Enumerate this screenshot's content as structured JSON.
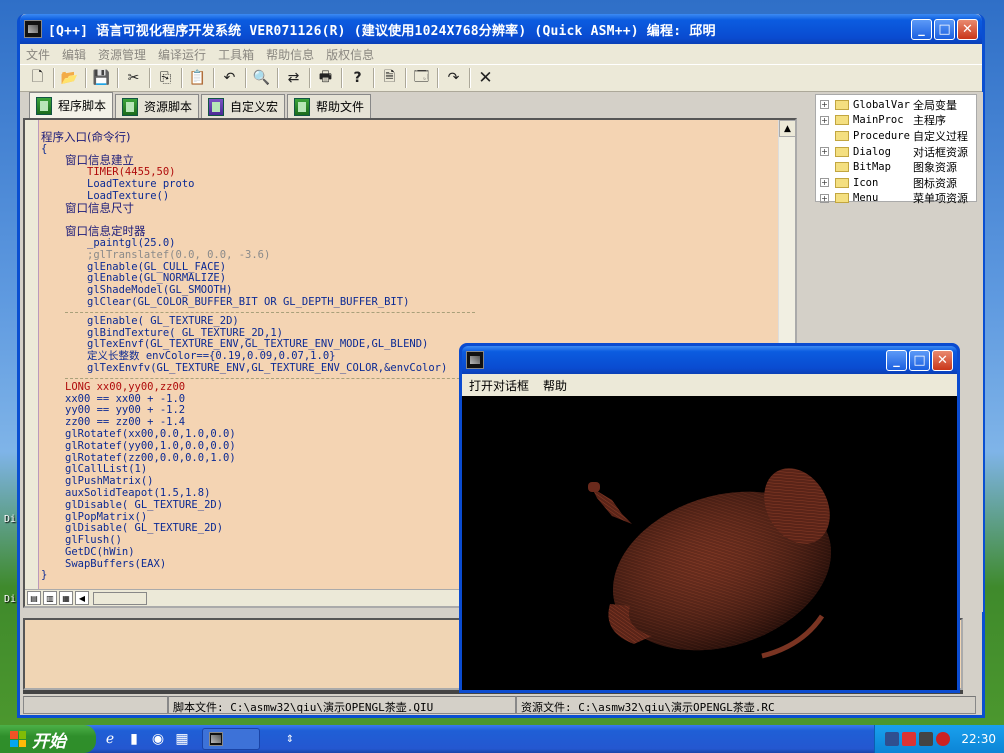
{
  "window": {
    "title": "[Q++] 语言可视化程序开发系统  VER071126(R) (建议使用1024X768分辨率) (Quick ASM++) 编程: 邱明",
    "min_label": "_",
    "max_label": "□",
    "close_label": "✕"
  },
  "menu": [
    "文件",
    "编辑",
    "资源管理",
    "编译运行",
    "工具箱",
    "帮助信息",
    "版权信息"
  ],
  "toolbar": {
    "icons": [
      "new-file-icon",
      "open-folder-icon",
      "save-icon",
      "cut-icon",
      "copy-icon",
      "paste-icon",
      "undo-icon",
      "find-icon",
      "replace-icon",
      "print-icon",
      "context-help-icon",
      "preview-icon",
      "properties-icon",
      "redo-icon",
      "close-icon"
    ],
    "glyphs": [
      "🗋",
      "📂",
      "💾",
      "✂",
      "⎘",
      "📋",
      "↶",
      "🔍",
      "⇄",
      "🖶",
      "?",
      "🗎",
      "🗔",
      "↷",
      "✕"
    ]
  },
  "tabs": [
    "程序脚本",
    "资源脚本",
    "自定义宏",
    "帮助文件"
  ],
  "code": {
    "header": "程序入口(命令行)",
    "brace_open": "{",
    "sec1": "窗口信息建立",
    "timer": "TIMER(4455,50)",
    "load1": "LoadTexture proto",
    "load2": "LoadTexture()",
    "sec2": "窗口信息尺寸",
    "sec3": "窗口信息定时器",
    "paint": "_paintgl(25.0)",
    "translate": ";glTranslatef(0.0, 0.0, -3.6)",
    "e1": "glEnable(GL_CULL_FACE)",
    "e2": "glEnable(GL_NORMALIZE)",
    "shade": "glShadeModel(GL_SMOOTH)",
    "clear": "glClear(GL_COLOR_BUFFER_BIT OR GL_DEPTH_BUFFER_BIT)",
    "e3": "glEnable( GL_TEXTURE_2D)",
    "bind": "glBindTexture( GL_TEXTURE_2D,1)",
    "texenvf": "glTexEnvf(GL_TEXTURE_ENV,GL_TEXTURE_ENV_MODE,GL_BLEND)",
    "define": "定义长整数 envColor=={0.19,0.09,0.07,1.0}",
    "texenvfv": "glTexEnvfv(GL_TEXTURE_ENV,GL_TEXTURE_ENV_COLOR,&envColor)",
    "long": "LONG xx00,yy00,zz00",
    "xx": "xx00 == xx00 + -1.0",
    "yy": "yy00 == yy00 + -1.2",
    "zz": "zz00 == zz00 + -1.4",
    "r1": "glRotatef(xx00,0.0,1.0,0.0)",
    "r2": "glRotatef(yy00,1.0,0.0,0.0)",
    "r3": "glRotatef(zz00,0.0,0.0,1.0)",
    "call": "glCallList(1)",
    "push": "glPushMatrix()",
    "teapot": "auxSolidTeapot(1.5,1.8)",
    "d1": "glDisable( GL_TEXTURE_2D)",
    "pop": "glPopMatrix()",
    "d2": "glDisable( GL_TEXTURE_2D)",
    "flush": "glFlush()",
    "getdc": "GetDC(hWin)",
    "swap": "SwapBuffers(EAX)",
    "brace_close": "}"
  },
  "tree": [
    {
      "name": "GlobalVar",
      "desc": "全局变量",
      "expand": true
    },
    {
      "name": "MainProc",
      "desc": "主程序",
      "expand": true
    },
    {
      "name": "Procedure",
      "desc": "自定义过程",
      "expand": false
    },
    {
      "name": "Dialog",
      "desc": "对话框资源",
      "expand": true
    },
    {
      "name": "BitMap",
      "desc": "图象资源",
      "expand": false
    },
    {
      "name": "Icon",
      "desc": "图标资源",
      "expand": true
    },
    {
      "name": "Menu",
      "desc": "菜单项资源",
      "expand": true
    }
  ],
  "status": {
    "script": "脚本文件: C:\\asmw32\\qiu\\演示OPENGL茶壶.QIU",
    "resource": "资源文件: C:\\asmw32\\qiu\\演示OPENGL茶壶.RC"
  },
  "glwin": {
    "menu": [
      "打开对话框",
      "帮助"
    ]
  },
  "taskbar": {
    "start": "开始",
    "clock": "22:30"
  },
  "desktop": [
    "Di",
    "Di"
  ]
}
